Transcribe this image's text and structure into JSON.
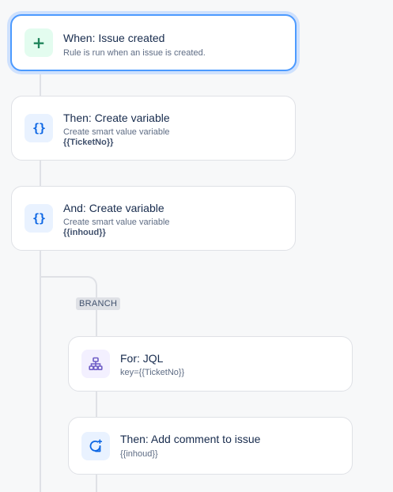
{
  "trigger": {
    "title": "When: Issue created",
    "subtitle": "Rule is run when an issue is created.",
    "icon": "plus-icon"
  },
  "actions": [
    {
      "title": "Then: Create variable",
      "subtitle": "Create smart value variable",
      "value": "{{TicketNo}}",
      "icon": "curly-braces-icon"
    },
    {
      "title": "And: Create variable",
      "subtitle": "Create smart value variable",
      "value": "{{inhoud}}",
      "icon": "curly-braces-icon"
    }
  ],
  "branch": {
    "label": "BRANCH",
    "items": [
      {
        "title": "For: JQL",
        "subtitle": "key={{TicketNo}}",
        "icon": "hierarchy-icon"
      },
      {
        "title": "Then: Add comment to issue",
        "subtitle": "{{inhoud}}",
        "icon": "comment-add-icon"
      }
    ]
  },
  "colors": {
    "selected_border": "#4c9aff",
    "trigger_icon": "#1f845a",
    "action_icon": "#0c66e4",
    "branch_icon": "#6e5dc6"
  }
}
